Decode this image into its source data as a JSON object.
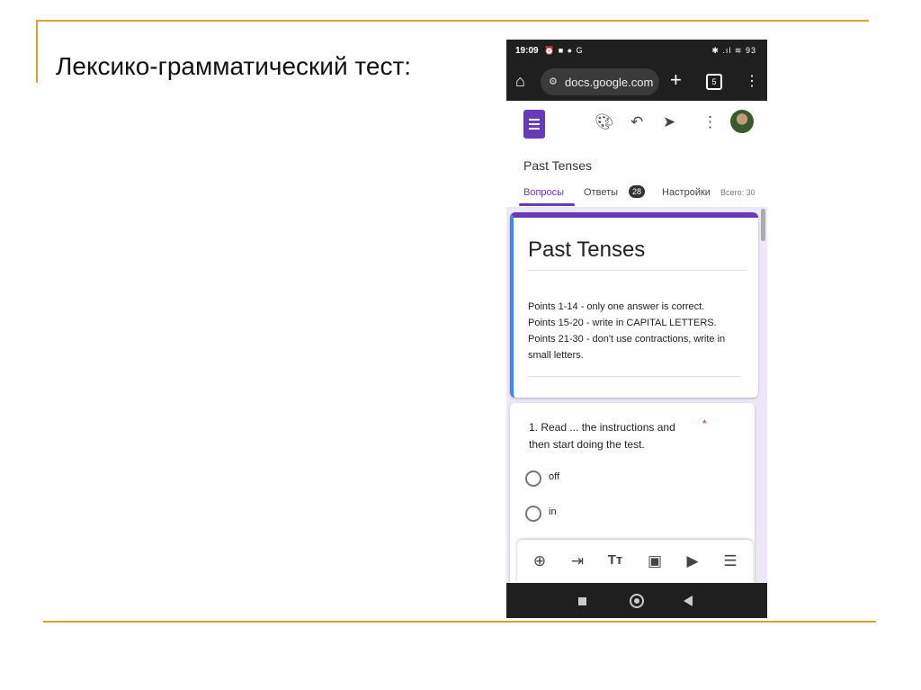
{
  "slide": {
    "title": "Лексико-грамматический тест:"
  },
  "status_bar": {
    "time": "19:09",
    "right_icons": "✱ .ıl ≋ 93"
  },
  "browser": {
    "url": "docs.google.com",
    "tab_count": "5"
  },
  "form": {
    "name": "Past Tenses",
    "tabs": {
      "questions": "Вопросы",
      "answers": "Ответы",
      "answers_badge": "28",
      "settings": "Настройки"
    },
    "total": "Всего: 30",
    "title": "Past Tenses",
    "description": [
      "Points 1-14 - only one answer is correct.",
      "Points 15-20 - write in CAPITAL LETTERS.",
      "Points 21-30 - don't use contractions, write in small letters."
    ],
    "question": {
      "text": "1. Read ... the instructions and then start doing the test.",
      "required_mark": "*",
      "options": [
        "off",
        "in"
      ]
    }
  },
  "colors": {
    "accent": "#673ab7",
    "rule": "#d6a42a",
    "side_accent": "#4285f4"
  }
}
